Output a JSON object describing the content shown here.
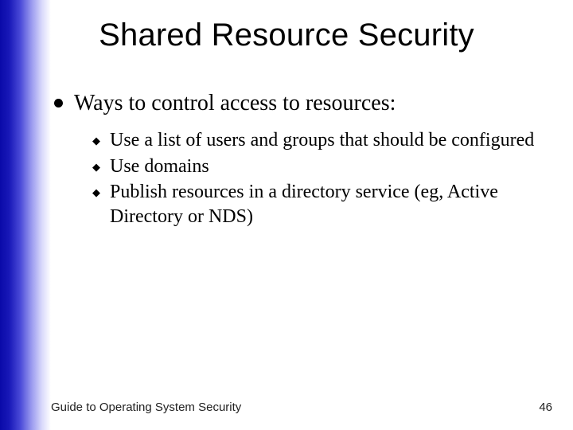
{
  "title": "Shared Resource Security",
  "main_point": "Ways to control access to resources:",
  "sub_points": {
    "a": "Use a list of users and groups that should be configured",
    "b": "Use domains",
    "c": "Publish resources in a directory service (eg, Active Directory or NDS)"
  },
  "footer": {
    "source": "Guide to Operating System Security",
    "page": "46"
  }
}
